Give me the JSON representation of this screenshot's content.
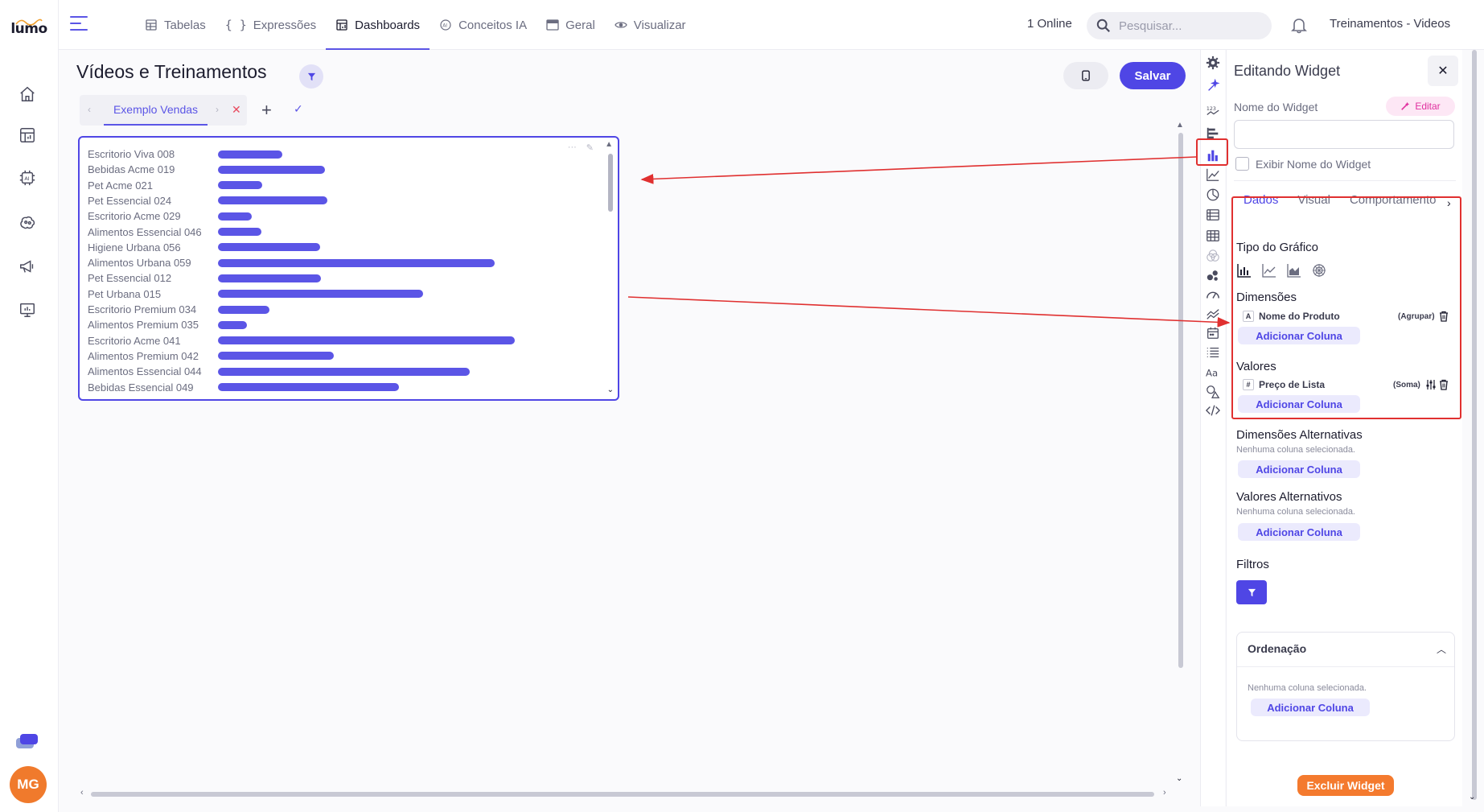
{
  "app": {
    "logo_text": "lumo",
    "user_initials": "MG",
    "workspace": "Treinamentos - Videos",
    "online": "1 Online",
    "search_placeholder": "Pesquisar..."
  },
  "nav_tabs": [
    {
      "label": "Tabelas",
      "icon": "table-icon"
    },
    {
      "label": "Expressões",
      "icon": "braces-icon"
    },
    {
      "label": "Dashboards",
      "icon": "dashboard-icon"
    },
    {
      "label": "Conceitos IA",
      "icon": "ai-icon"
    },
    {
      "label": "Geral",
      "icon": "window-icon"
    },
    {
      "label": "Visualizar",
      "icon": "eye-icon"
    }
  ],
  "left_nav": [
    "home-icon",
    "dashboard-icon",
    "ai-chip-icon",
    "brain-icon",
    "megaphone-icon",
    "presentation-icon"
  ],
  "dashboard": {
    "title": "Vídeos e Treinamentos",
    "save_label": "Salvar",
    "sheet_tab": "Exemplo Vendas"
  },
  "chart_data": {
    "type": "bar",
    "orientation": "horizontal",
    "categories": [
      "Escritorio Viva 008",
      "Bebidas Acme 019",
      "Pet Acme 021",
      "Pet Essencial 024",
      "Escritorio Acme 029",
      "Alimentos Essencial 046",
      "Higiene Urbana 056",
      "Alimentos Urbana 059",
      "Pet Essencial 012",
      "Pet Urbana 015",
      "Escritorio Premium 034",
      "Alimentos Premium 035",
      "Escritorio Acme 041",
      "Alimentos Premium 042",
      "Alimentos Essencial 044",
      "Bebidas Essencial 049"
    ],
    "values": [
      80,
      133,
      55,
      136,
      42,
      54,
      127,
      344,
      128,
      255,
      64,
      36,
      369,
      144,
      313,
      225
    ],
    "bar_color": "#5b55e6"
  },
  "panel": {
    "title": "Editando Widget",
    "name_label": "Nome do Widget",
    "edit_label": "Editar",
    "name_value": "",
    "show_name_label": "Exibir Nome do Widget",
    "tabs": [
      "Dados",
      "Visual",
      "Comportamento"
    ],
    "chart_type_label": "Tipo do Gráfico",
    "dimensions_label": "Dimensões",
    "dimension_column": {
      "type": "A",
      "name": "Nome do Produto",
      "agg": "(Agrupar)"
    },
    "values_label": "Valores",
    "value_column": {
      "type": "#",
      "name": "Preço de Lista",
      "agg": "(Soma)"
    },
    "add_column": "Adicionar Coluna",
    "alt_dimensions_label": "Dimensões Alternativas",
    "alt_values_label": "Valores Alternativos",
    "no_column": "Nenhuma coluna selecionada.",
    "filters_label": "Filtros",
    "ordering_label": "Ordenação",
    "delete_label": "Excluir Widget"
  },
  "colors": {
    "accent": "#4f46e5",
    "danger": "#f47a2e",
    "annotation": "#e03030"
  }
}
